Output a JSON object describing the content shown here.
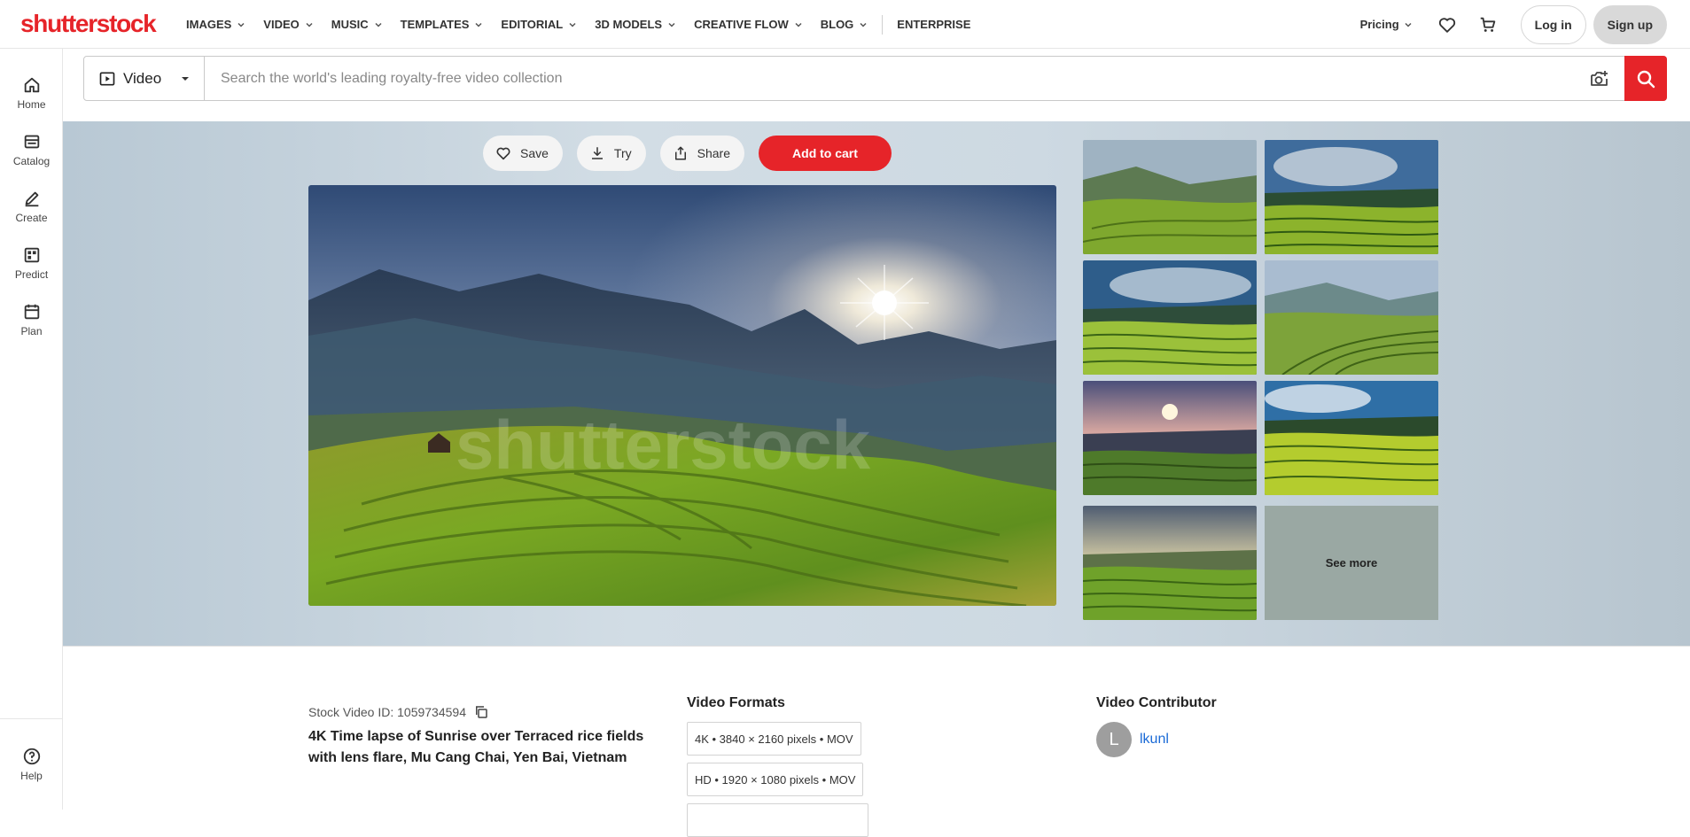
{
  "header": {
    "logo": "shutterstock",
    "nav": [
      {
        "label": "IMAGES",
        "dropdown": true
      },
      {
        "label": "VIDEO",
        "dropdown": true
      },
      {
        "label": "MUSIC",
        "dropdown": true
      },
      {
        "label": "TEMPLATES",
        "dropdown": true
      },
      {
        "label": "EDITORIAL",
        "dropdown": true
      },
      {
        "label": "3D MODELS",
        "dropdown": true
      },
      {
        "label": "CREATIVE FLOW",
        "dropdown": true
      },
      {
        "label": "BLOG",
        "dropdown": true
      },
      {
        "label": "ENTERPRISE",
        "dropdown": false
      }
    ],
    "pricing": "Pricing",
    "login": "Log in",
    "signup": "Sign up"
  },
  "rail": {
    "items": [
      "Home",
      "Catalog",
      "Create",
      "Predict",
      "Plan"
    ],
    "help": "Help"
  },
  "search": {
    "media_type": "Video",
    "placeholder": "Search the world's leading royalty-free video collection"
  },
  "actions": {
    "save": "Save",
    "try": "Try",
    "share": "Share",
    "add_to_cart": "Add to cart"
  },
  "preview": {
    "watermark": "shutterstock",
    "see_more": "See more"
  },
  "details": {
    "stock_id": "Stock Video ID: 1059734594",
    "title": "4K Time lapse of Sunrise over Terraced rice fields with lens flare, Mu Cang Chai, Yen Bai, Vietnam",
    "formats_heading": "Video Formats",
    "formats": [
      "4K • 3840 × 2160 pixels • MOV",
      "HD • 1920 × 1080 pixels • MOV"
    ],
    "contributor_heading": "Video Contributor",
    "contributor_initial": "L",
    "contributor_name": "lkunl"
  },
  "colors": {
    "brand_red": "#e62429",
    "link_blue": "#1a6ad6"
  }
}
